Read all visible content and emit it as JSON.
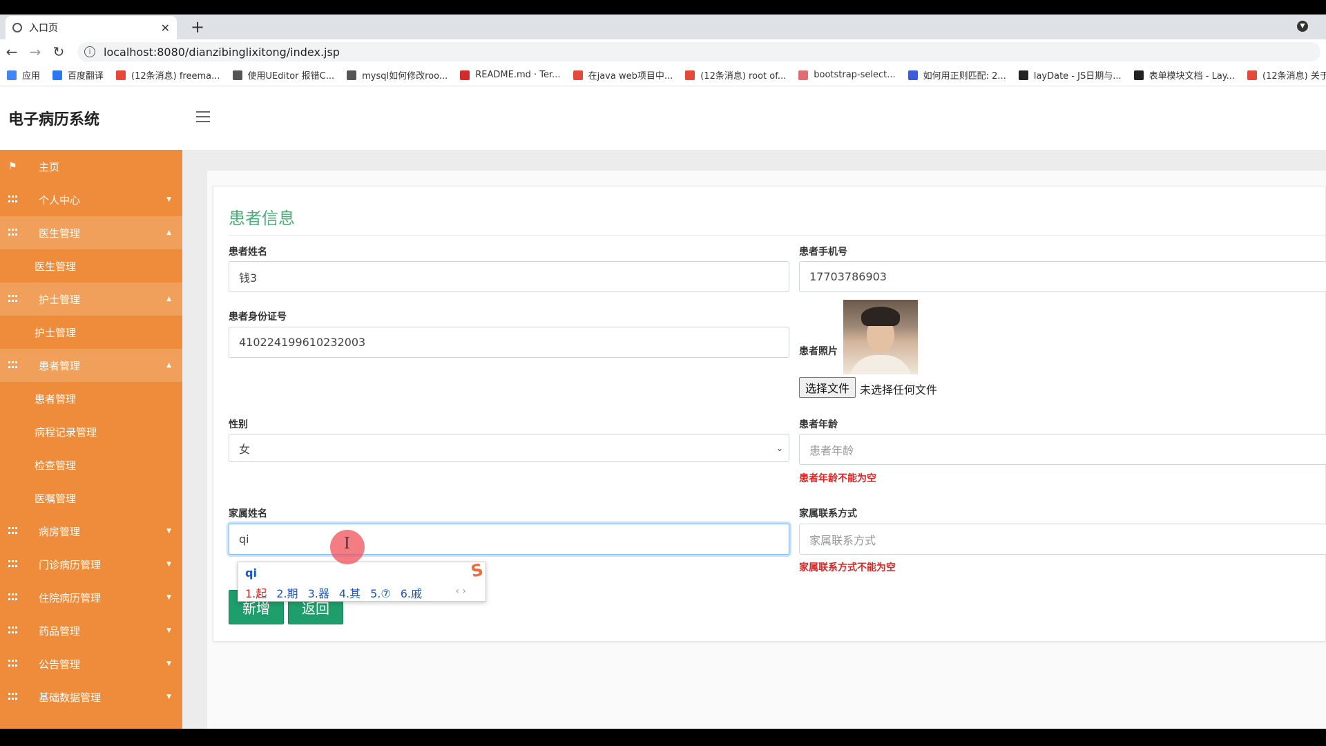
{
  "browser": {
    "tab_title": "入口页",
    "url": "localhost:8080/dianzibinglixitong/index.jsp",
    "bookmarks": [
      {
        "label": "应用",
        "color": "#4285f4"
      },
      {
        "label": "百度翻译",
        "color": "#2b76f1"
      },
      {
        "label": "(12条消息) freema...",
        "color": "#e5493a"
      },
      {
        "label": "使用UEditor 报错C...",
        "color": "#555555"
      },
      {
        "label": "mysql如何修改roo...",
        "color": "#555555"
      },
      {
        "label": "README.md · Ter...",
        "color": "#d62929"
      },
      {
        "label": "在java web项目中...",
        "color": "#e5493a"
      },
      {
        "label": "(12条消息) root of...",
        "color": "#e5493a"
      },
      {
        "label": "bootstrap-select...",
        "color": "#e06c75"
      },
      {
        "label": "如何用正则匹配: 2...",
        "color": "#3b5bdb"
      },
      {
        "label": "layDate - JS日期与...",
        "color": "#222222"
      },
      {
        "label": "表单模块文档 - Lay...",
        "color": "#222222"
      },
      {
        "label": "(12条消息) 关于la",
        "color": "#e5493a"
      }
    ]
  },
  "app": {
    "brand": "电子病历系统"
  },
  "sidebar": {
    "items": [
      {
        "label": "主页",
        "type": "home"
      },
      {
        "label": "个人中心",
        "type": "group",
        "caret": "▼"
      },
      {
        "label": "医生管理",
        "type": "group-open",
        "caret": "▲"
      },
      {
        "label": "医生管理",
        "type": "sub"
      },
      {
        "label": "护士管理",
        "type": "group-open",
        "caret": "▲"
      },
      {
        "label": "护士管理",
        "type": "sub"
      },
      {
        "label": "患者管理",
        "type": "group-open",
        "caret": "▲"
      },
      {
        "label": "患者管理",
        "type": "sub"
      },
      {
        "label": "病程记录管理",
        "type": "sub"
      },
      {
        "label": "检查管理",
        "type": "sub"
      },
      {
        "label": "医嘱管理",
        "type": "sub"
      },
      {
        "label": "病房管理",
        "type": "group",
        "caret": "▼"
      },
      {
        "label": "门诊病历管理",
        "type": "group",
        "caret": "▼"
      },
      {
        "label": "住院病历管理",
        "type": "group",
        "caret": "▼"
      },
      {
        "label": "药品管理",
        "type": "group",
        "caret": "▼"
      },
      {
        "label": "公告管理",
        "type": "group",
        "caret": "▼"
      },
      {
        "label": "基础数据管理",
        "type": "group",
        "caret": "▼"
      }
    ]
  },
  "form": {
    "title": "患者信息",
    "patient_name": {
      "label": "患者姓名",
      "value": "钱3"
    },
    "patient_phone": {
      "label": "患者手机号",
      "value": "17703786903"
    },
    "patient_id": {
      "label": "患者身份证号",
      "value": "410224199610232003"
    },
    "patient_photo": {
      "label": "患者照片",
      "button": "选择文件",
      "status": "未选择任何文件"
    },
    "gender": {
      "label": "性别",
      "value": "女"
    },
    "age": {
      "label": "患者年龄",
      "placeholder": "患者年龄",
      "error": "患者年龄不能为空"
    },
    "family_name": {
      "label": "家属姓名",
      "value": "qi"
    },
    "family_contact": {
      "label": "家属联系方式",
      "placeholder": "家属联系方式",
      "error": "家属联系方式不能为空"
    },
    "buttons": {
      "add": "新增",
      "back": "返回"
    }
  },
  "ime": {
    "pinyin": "qi",
    "candidates": [
      "1.起",
      "2.期",
      "3.器",
      "4.其",
      "5.⑦",
      "6.戚"
    ],
    "nav": "‹ ›",
    "logo": "S"
  }
}
